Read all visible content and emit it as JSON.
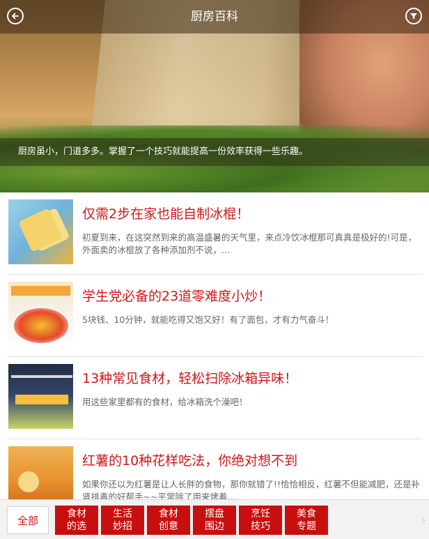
{
  "header": {
    "title": "厨房百科",
    "back_icon": "back-arrow-icon",
    "filter_icon": "filter-icon"
  },
  "hero": {
    "caption": "厨房虽小，门道多多。掌握了一个技巧就能提高一份效率获得一些乐趣。"
  },
  "articles": [
    {
      "title": "仅需2步在家也能自制冰棍！",
      "summary": "初夏到来，在这突然到来的高温盛暑的天气里，来点冷饮冰棍那可真真是极好的!可是，外面卖的冰棍放了各种添加剂不说，..."
    },
    {
      "title": "学生党必备的23道零难度小炒！",
      "summary": "5块钱、10分钟，就能吃得又饱又好！有了面包，才有力气奋斗！"
    },
    {
      "title": "13种常见食材，轻松扫除冰箱异味！",
      "summary": "用这些家里都有的食材，给冰箱洗个澡吧！"
    },
    {
      "title": "红薯的10种花样吃法，你绝对想不到",
      "summary": "如果你还以为红薯是让人长胖的食物，那你就错了!!恰恰相反，红薯不但能减肥，还是补肾排毒的好帮手~~平常除了用来烤着..."
    }
  ],
  "tabs": {
    "all_label": "全部",
    "items": [
      {
        "line1": "食材",
        "line2": "的选"
      },
      {
        "line1": "生活",
        "line2": "妙招"
      },
      {
        "line1": "食材",
        "line2": "创意"
      },
      {
        "line1": "摆盘",
        "line2": "围边"
      },
      {
        "line1": "烹饪",
        "line2": "技巧"
      },
      {
        "line1": "美食",
        "line2": "专题"
      }
    ],
    "more_glyph": "›"
  },
  "colors": {
    "accent": "#d0161a",
    "tab_bg": "#c80f0f"
  }
}
